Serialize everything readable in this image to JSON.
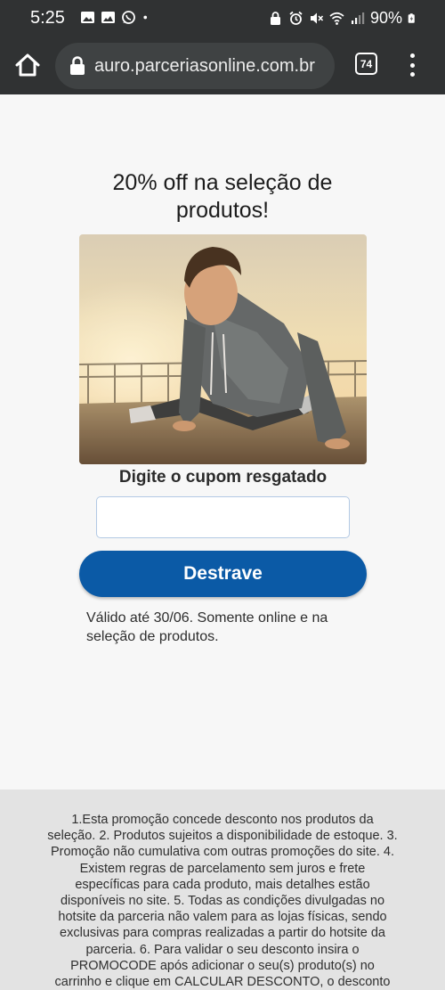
{
  "status_bar": {
    "time": "5:25",
    "battery": "90%"
  },
  "browser": {
    "url": "auro.parceriasonline.com.br",
    "tab_count": "74"
  },
  "promo": {
    "headline": "20% off na seleção de produtos!",
    "coupon_label": "Digite o cupom resgatado",
    "coupon_value": "",
    "cta_label": "Destrave",
    "validity_text": "Válido até 30/06. Somente online e na seleção de produtos."
  },
  "terms": {
    "text": "1.Esta promoção concede desconto nos produtos da seleção. 2. Produtos sujeitos a disponibilidade de estoque. 3. Promoção não cumulativa com outras promoções do site. 4. Existem regras de parcelamento sem juros e frete específicas para cada produto, mais detalhes estão disponíveis no site. 5. Todas as condições divulgadas no hotsite da parceria não valem para as lojas físicas, sendo exclusivas para compras realizadas a partir do hotsite da parceria. 6. Para validar o seu desconto insira o PROMOCODE após adicionar o seu(s) produto(s) no carrinho e clique em CALCULAR DESCONTO, o desconto"
  },
  "colors": {
    "chrome_bar": "#303233",
    "cta_blue": "#0b5aa6",
    "page_bg": "#f7f7f7",
    "terms_bg": "#e3e3e3"
  }
}
